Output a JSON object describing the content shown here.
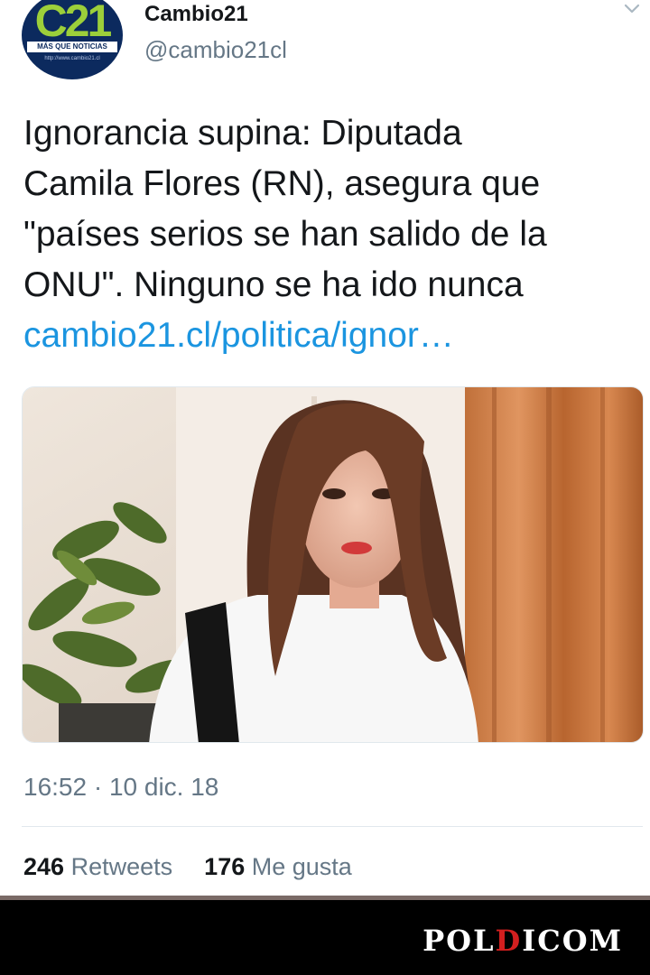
{
  "tweet": {
    "account": {
      "display_name": "Cambio21",
      "handle": "@cambio21cl",
      "avatar": {
        "logo_text": "C21",
        "tagline": "MÁS QUE NOTICIAS",
        "url": "http://www.cambio21.cl"
      }
    },
    "text_lines": [
      "Ignorancia supina: Diputada",
      "Camila Flores (RN), asegura que",
      "\"países serios se han salido de la",
      "ONU\". Ninguno se ha ido nunca"
    ],
    "link": "cambio21.cl/politica/ignor…",
    "timestamp": "16:52 · 10 dic. 18",
    "stats": {
      "retweets_count": "246",
      "retweets_label": "Retweets",
      "likes_count": "176",
      "likes_label": "Me gusta"
    }
  },
  "watermark": {
    "part1": "POL",
    "accent": "D",
    "part2": "ICOM"
  },
  "icons": {
    "menu": "chevron-down-icon"
  },
  "colors": {
    "link": "#1b95e0",
    "secondary_text": "#657786",
    "primary_text": "#14171a",
    "avatar_bg": "#0c2a5e",
    "brand_accent": "#d21f1f"
  }
}
